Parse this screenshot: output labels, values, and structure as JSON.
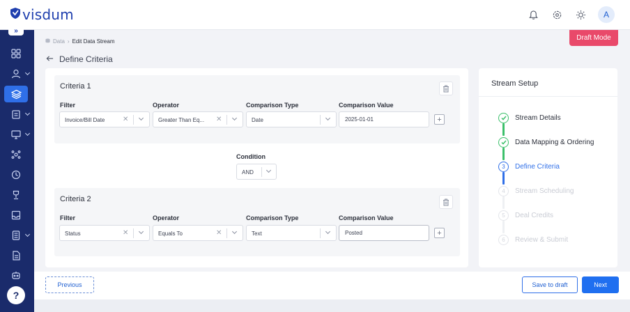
{
  "app": {
    "logo_text": "visdum",
    "avatar_initial": "A"
  },
  "colors": {
    "brand": "#1f3fae",
    "sidebar": "#1a2b6b",
    "accent": "#2f6fe8",
    "success": "#3cc06b",
    "danger": "#e9496a"
  },
  "breadcrumb": {
    "root": "Data",
    "current": "Edit Data Stream"
  },
  "page": {
    "title": "Define Criteria",
    "draft_mode": "Draft Mode"
  },
  "criteria": [
    {
      "title": "Criteria 1",
      "labels": {
        "filter": "Filter",
        "operator": "Operator",
        "comparison_type": "Comparison Type",
        "comparison_value": "Comparison Value"
      },
      "filter": "Invoice/Bill Date",
      "operator": "Greater Than Eq...",
      "comparison_type": "Date",
      "comparison_value": "2025-01-01"
    },
    {
      "title": "Criteria 2",
      "labels": {
        "filter": "Filter",
        "operator": "Operator",
        "comparison_type": "Comparison Type",
        "comparison_value": "Comparison Value"
      },
      "filter": "Status",
      "operator": "Equals To",
      "comparison_type": "Text",
      "comparison_value": "Posted"
    }
  ],
  "condition": {
    "label": "Condition",
    "value": "AND"
  },
  "setup": {
    "title": "Stream Setup",
    "steps": [
      {
        "label": "Stream Details",
        "state": "done",
        "number": ""
      },
      {
        "label": "Data Mapping & Ordering",
        "state": "done",
        "number": ""
      },
      {
        "label": "Define Criteria",
        "state": "current",
        "number": "3"
      },
      {
        "label": "Stream Scheduling",
        "state": "todo",
        "number": "4"
      },
      {
        "label": "Deal Credits",
        "state": "todo",
        "number": "5"
      },
      {
        "label": "Review & Submit",
        "state": "todo",
        "number": "6"
      }
    ]
  },
  "footer": {
    "previous": "Previous",
    "save_draft": "Save to draft",
    "next": "Next"
  },
  "sidebar": {
    "collapse_glyph": "»",
    "help_glyph": "?",
    "icons": [
      "dashboard-icon",
      "user-icon",
      "layers-icon",
      "clipboard-icon",
      "monitor-icon",
      "network-icon",
      "clock-icon",
      "trophy-icon",
      "inbox-icon",
      "calculator-icon",
      "document-icon",
      "bot-icon"
    ]
  }
}
